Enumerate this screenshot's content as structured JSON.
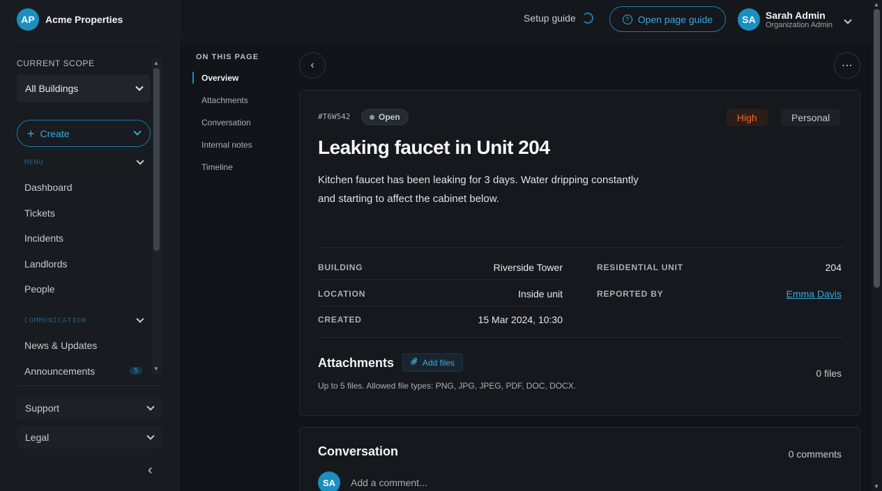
{
  "brand": {
    "initials": "AP",
    "name": "Acme Properties"
  },
  "sidebar": {
    "scope_label": "CURRENT SCOPE",
    "scope_value": "All Buildings",
    "create_label": "Create",
    "menu_heading": "MENU",
    "menu_items": [
      "Dashboard",
      "Tickets",
      "Incidents",
      "Landlords",
      "People"
    ],
    "communication_heading": "COMMUNICATION",
    "communication_items": [
      "News & Updates",
      "Announcements"
    ],
    "announcements_badge": "5",
    "support_label": "Support",
    "legal_label": "Legal"
  },
  "topbar": {
    "setup_label": "Setup guide",
    "guide_label": "Open page guide",
    "user_initials": "SA",
    "user_name": "Sarah Admin",
    "user_role": "Organization Admin"
  },
  "toc": {
    "title": "ON THIS PAGE",
    "items": [
      "Overview",
      "Attachments",
      "Conversation",
      "Internal notes",
      "Timeline"
    ]
  },
  "ticket": {
    "id": "#T6W542",
    "status": "Open",
    "priority": "High",
    "tag": "Personal",
    "title": "Leaking faucet in Unit 204",
    "description": "Kitchen faucet has been leaking for 3 days. Water dripping constantly and starting to affect the cabinet below.",
    "fields": {
      "building_label": "BUILDING",
      "building": "Riverside Tower",
      "unit_label": "RESIDENTIAL UNIT",
      "unit": "204",
      "location_label": "LOCATION",
      "location": "Inside unit",
      "reported_label": "REPORTED BY",
      "reported_by": "Emma Davis",
      "created_label": "CREATED",
      "created": "15 Mar 2024, 10:30"
    }
  },
  "attachments": {
    "title": "Attachments",
    "add_label": "Add files",
    "hint": "Up to 5 files. Allowed file types: PNG, JPG, JPEG, PDF, DOC, DOCX.",
    "count": "0 files"
  },
  "conversation": {
    "title": "Conversation",
    "count": "0 comments",
    "avatar": "SA",
    "placeholder": "Add a comment..."
  },
  "colors": {
    "accent": "#1a8fc0",
    "priority": "#f26a2a",
    "background": "#111419"
  }
}
